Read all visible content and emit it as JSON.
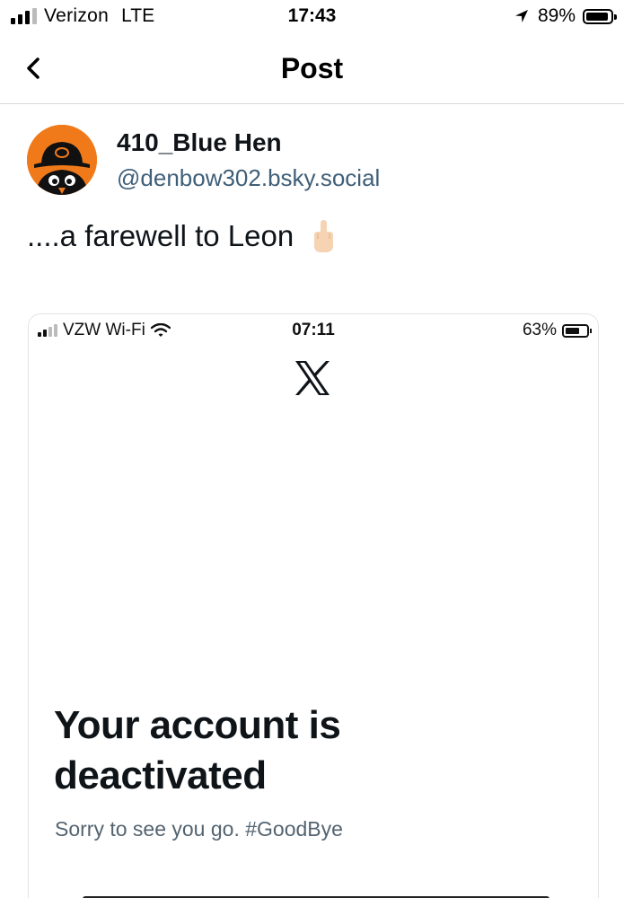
{
  "status_bar": {
    "carrier": "Verizon",
    "network": "LTE",
    "time": "17:43",
    "battery": "89%",
    "signal_icon": "cellular-signal-icon",
    "location_icon": "location-arrow-icon",
    "battery_icon": "battery-icon"
  },
  "header": {
    "title": "Post",
    "back_icon": "chevron-left-icon"
  },
  "post": {
    "author_name": "410_Blue Hen",
    "author_handle": "@denbow302.bsky.social",
    "text": "....a farewell to Leon",
    "emoji": "middle-finger-emoji",
    "avatar_icon": "oriole-bird-avatar"
  },
  "embedded_image": {
    "status_bar": {
      "carrier": "VZW Wi-Fi",
      "time": "07:11",
      "battery": "63%",
      "wifi_icon": "wifi-icon"
    },
    "logo": "x-logo-icon",
    "heading": "Your account is deactivated",
    "subtext": "Sorry to see you go. #GoodBye"
  },
  "colors": {
    "handle": "#3f5f78",
    "avatar_bg": "#f07a1a",
    "subtext": "#536471"
  }
}
